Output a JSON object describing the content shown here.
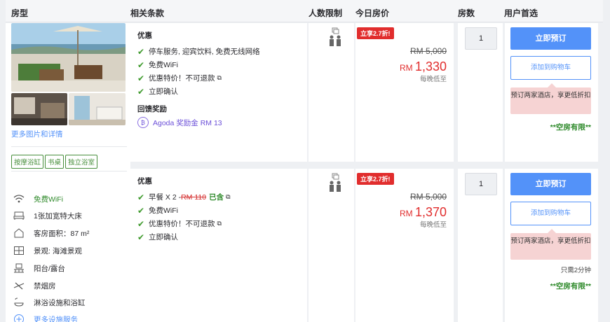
{
  "header": {
    "room_type": "房型",
    "conditions": "相关条款",
    "occupancy": "人数限制",
    "today_price": "今日房价",
    "rooms": "房数",
    "user_choice": "用户首选"
  },
  "room": {
    "more_photos_link": "更多图片和详情",
    "chips": [
      "按摩浴缸",
      "书桌",
      "独立浴室"
    ],
    "facilities": [
      {
        "icon": "wifi-icon",
        "label": "免费WiFi",
        "style": "green"
      },
      {
        "icon": "bed-icon",
        "label": "1张加宽特大床",
        "style": "normal"
      },
      {
        "icon": "house-icon",
        "label": "客房面积：87 m²",
        "style": "normal"
      },
      {
        "icon": "window-view-icon",
        "label": "景观: 海滩景观",
        "style": "normal"
      },
      {
        "icon": "balcony-icon",
        "label": "阳台/露台",
        "style": "normal"
      },
      {
        "icon": "no-smoking-icon",
        "label": "禁烟房",
        "style": "normal"
      },
      {
        "icon": "shower-icon",
        "label": "淋浴设施和浴缸",
        "style": "normal"
      },
      {
        "icon": "plus-circle-icon",
        "label": "更多设施服务",
        "style": "blue"
      }
    ]
  },
  "offers": [
    {
      "benefits_title": "优惠",
      "benefits": [
        "停车服务, 迎宾饮料, 免费无线网络",
        "免费WiFi",
        "优惠特价！不可退款",
        "立即确认"
      ],
      "reward_title": "回馈奖励",
      "reward_text": "Agoda 奖励金 RM 13",
      "deal_badge": "立享2.7折!",
      "old_price": "RM 5,000",
      "currency": "RM",
      "new_price": "1,330",
      "per_night": "每晚低至",
      "qty": "1",
      "book_label": "立即预订",
      "cart_label": "添加到购物车",
      "tip": "预订两家酒店，享更低折扣",
      "limited": "**空房有限**"
    },
    {
      "benefits_title": "优惠",
      "breakfast_prefix": "早餐 X 2 - ",
      "breakfast_old": "RM 110",
      "breakfast_included": "已含",
      "benefits": [
        "免费WiFi",
        "优惠特价！不可退款",
        "立即确认"
      ],
      "deal_badge": "立享2.7折!",
      "old_price": "RM 5,000",
      "currency": "RM",
      "new_price": "1,370",
      "per_night": "每晚低至",
      "qty": "1",
      "book_label": "立即预订",
      "cart_label": "添加到购物车",
      "tip": "预订两家酒店，享更低折扣",
      "wait": "只需2分钟",
      "limited": "**空房有限**"
    }
  ],
  "colors": {
    "accent_blue": "#5392f9",
    "deal_red": "#e12d2d",
    "check_green": "#3e9a2c",
    "tip_pink": "#f6d3d3"
  }
}
